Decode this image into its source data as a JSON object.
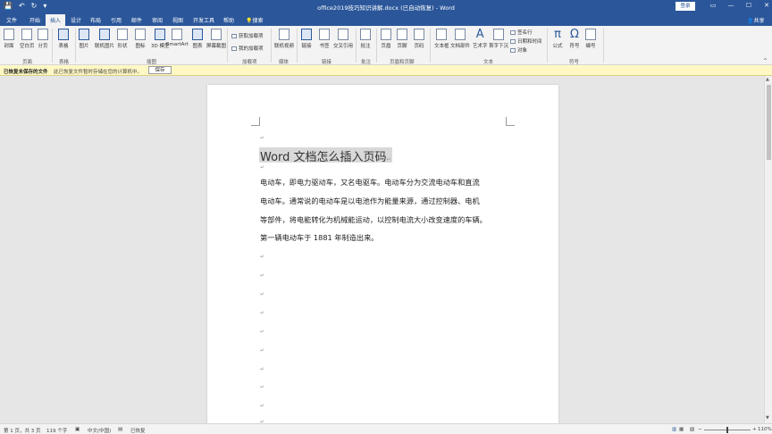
{
  "titlebar": {
    "qat": [
      "💾",
      "↶",
      "↻",
      "▾"
    ],
    "title": "office2019技巧知识讲解.docx (已自动恢复) - Word",
    "login": "登录",
    "winctl": [
      "▭",
      "—",
      "☐",
      "✕"
    ]
  },
  "tabs": {
    "items": [
      "文件",
      "开始",
      "插入",
      "设计",
      "布局",
      "引用",
      "邮件",
      "审阅",
      "视图",
      "开发工具",
      "帮助",
      "搜索"
    ],
    "active": "插入",
    "share": "共享"
  },
  "ribbon": {
    "buttons": [
      "封面",
      "空白页",
      "分页",
      "表格",
      "图片",
      "联机图片",
      "形状",
      "图标",
      "3D 模型",
      "SmartArt",
      "图表",
      "屏幕截图",
      "联机视频",
      "链接",
      "书签",
      "交叉引用",
      "批注",
      "页眉",
      "页脚",
      "页码",
      "文本框",
      "文档部件",
      "艺术字",
      "首字下沉",
      "公式",
      "符号",
      "编号"
    ],
    "small": [
      "获取加载项",
      "我的加载项",
      "签名行",
      "日期和时间",
      "对象"
    ],
    "groups": [
      "页面",
      "表格",
      "插图",
      "加载项",
      "媒体",
      "链接",
      "批注",
      "页眉和页脚",
      "文本",
      "符号"
    ],
    "collapse": "^"
  },
  "infobar": {
    "title": "已恢复未保存的文件",
    "message": "此已恢复文件暂时存储在您的计算机中。",
    "save_button": "保存"
  },
  "document": {
    "pilcrow": "↵",
    "heading": "Word 文档怎么插入页码",
    "lines": [
      "电动车，即电力驱动车，又名电驱车。电动车分为交流电动车和直流",
      "电动车。通常说的电动车是以电池作为能量来源，通过控制器、电机",
      "等部件，将电能转化为机械能运动，以控制电流大小改变速度的车辆。",
      "第一辆电动车于 1881 年制造出来。"
    ]
  },
  "statusbar": {
    "page": "第 1 页，共 3 页",
    "words": "119 个字",
    "language": "中文(中国)",
    "recovered": "已恢复",
    "zoom": "110%"
  }
}
